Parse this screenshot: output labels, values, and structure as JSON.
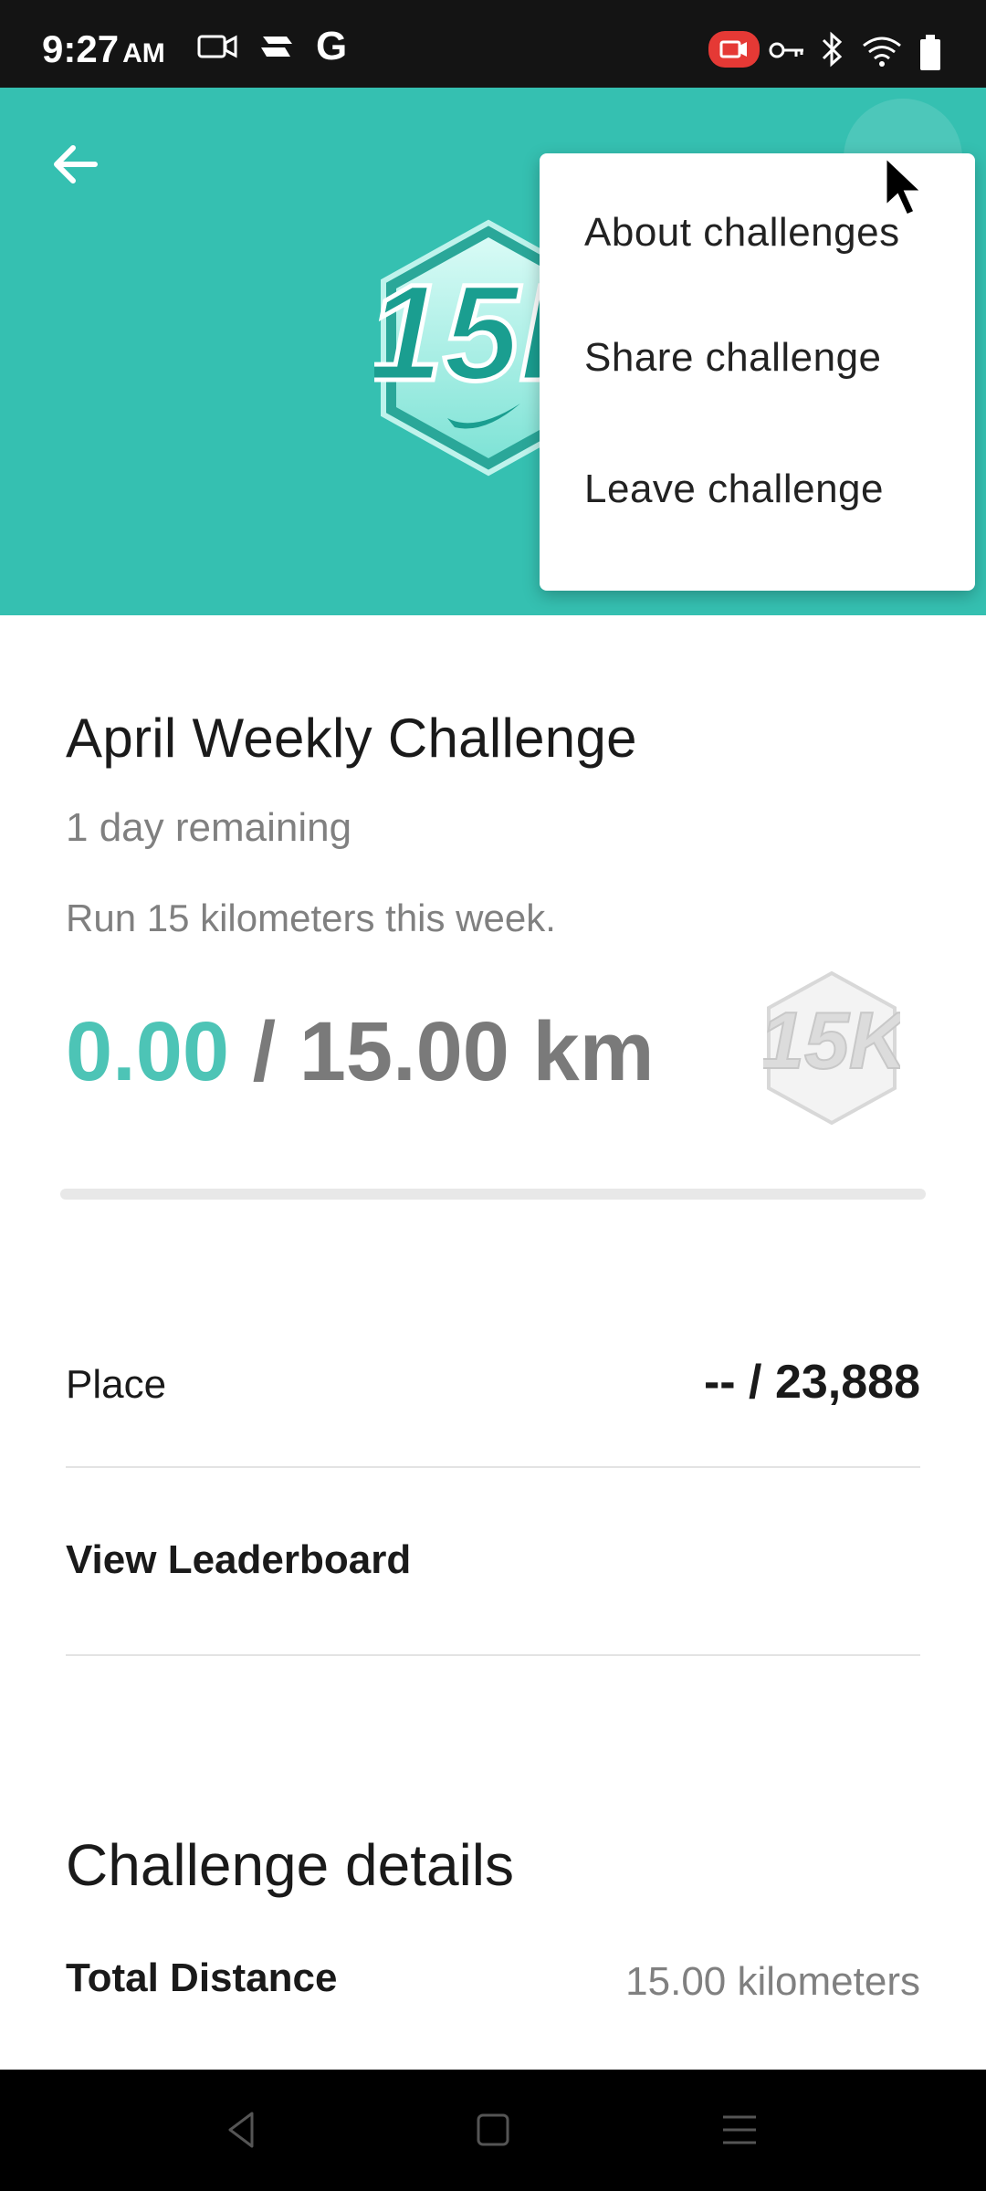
{
  "status_bar": {
    "time": "9:27",
    "ampm": "AM",
    "icons": [
      "video-camera-icon",
      "game-controller-icon",
      "google-icon",
      "screen-record-icon",
      "key-icon",
      "bluetooth-icon",
      "wifi-icon",
      "battery-icon"
    ],
    "record_color": "#e53935"
  },
  "header": {
    "color": "#35c0b1",
    "badge_text": "15K",
    "icons": [
      "back-arrow-icon",
      "more-vert-icon"
    ]
  },
  "menu": {
    "items": [
      {
        "label": "About challenges"
      },
      {
        "label": "Share challenge"
      },
      {
        "label": "Leave challenge"
      }
    ]
  },
  "challenge": {
    "title": "April Weekly Challenge",
    "remaining": "1 day remaining",
    "description": "Run 15 kilometers this week.",
    "current_distance": "0.00",
    "goal_distance": "/ 15.00 km",
    "progress_fraction": 0,
    "accent_color": "#4dc4b6"
  },
  "place": {
    "label": "Place",
    "value": "-- / 23,888"
  },
  "leaderboard": {
    "label": "View Leaderboard"
  },
  "details": {
    "title": "Challenge details",
    "total_distance_label": "Total Distance",
    "total_distance_value": "15.00 kilometers"
  },
  "nav_bar": {
    "icons": [
      "back-triangle-icon",
      "home-square-icon",
      "recents-menu-icon"
    ]
  }
}
